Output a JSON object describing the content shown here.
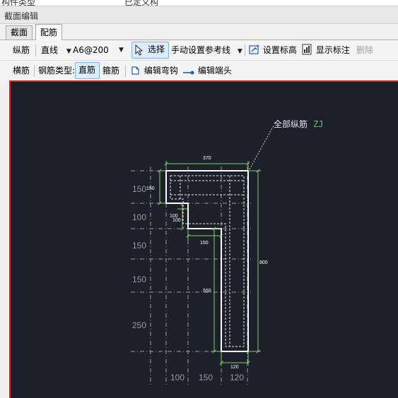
{
  "top_strip": {
    "left_text": "构件类型",
    "right_text": "已定义构"
  },
  "window": {
    "title": "截面编辑"
  },
  "tabs": [
    {
      "label": "截面"
    },
    {
      "label": "配筋"
    }
  ],
  "toolbar1": {
    "rebar_label": "纵筋",
    "line_type": "直线",
    "spec_value": "A6@200",
    "select_label": "选择",
    "manual_ref_label": "手动设置参考线",
    "set_elevation_label": "设置标高",
    "show_annotation_label": "显示标注",
    "delete_label": "删除"
  },
  "toolbar2": {
    "horizontal_label": "横筋",
    "rebar_type_label": "钢筋类型:",
    "straight_label": "直筋",
    "stirrup_label": "箍筋",
    "edit_hook_label": "编辑弯钩",
    "edit_end_label": "编辑端头"
  },
  "drawing": {
    "annotation_text": "全部纵筋",
    "annotation_code": "ZJ",
    "dim_top": "370",
    "dim_150_left": "150",
    "dim_100_a": "100",
    "dim_100_b": "100",
    "dim_150_mid": "150",
    "dim_550": "550",
    "dim_800": "800",
    "dim_120": "120",
    "grid_left": [
      "150",
      "100",
      "150",
      "150",
      "250"
    ],
    "grid_bottom": [
      "100",
      "150",
      "120"
    ],
    "colors": {
      "background": "#1d1f2b",
      "outline": "#ffffff",
      "dimension": "#7cd06a",
      "grid": "#9a9a9a",
      "code": "#3fe03f",
      "border": "#e02020"
    }
  }
}
